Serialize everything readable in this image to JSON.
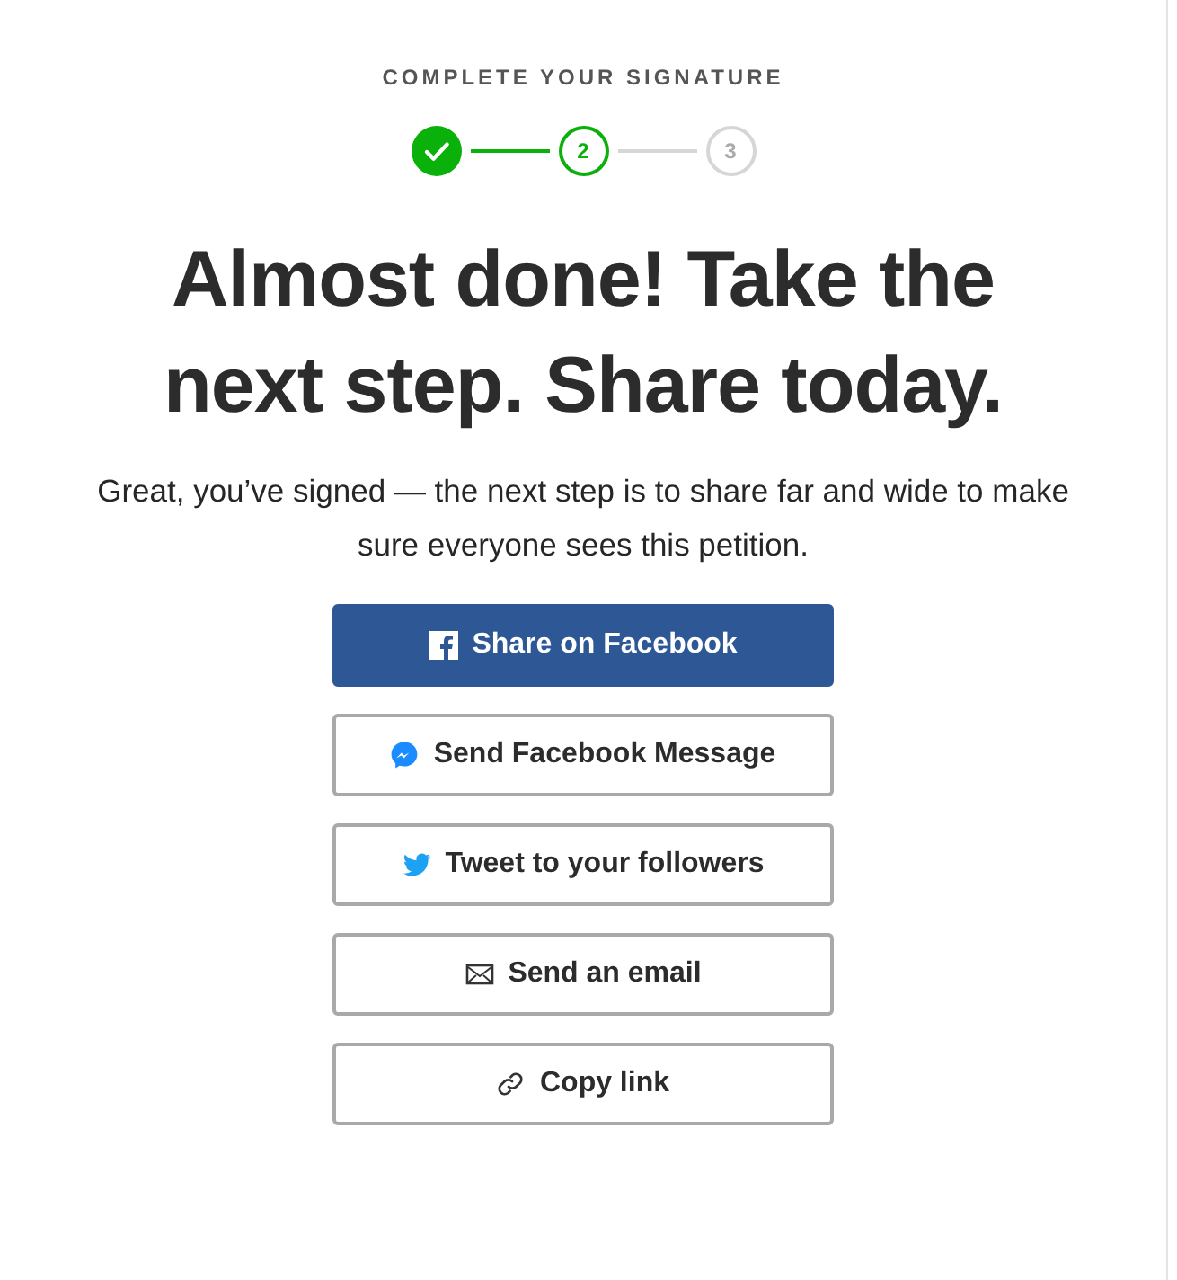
{
  "eyebrow": "COMPLETE YOUR SIGNATURE",
  "steps": [
    {
      "done": true,
      "selected": false
    },
    {
      "label": "2",
      "done": false,
      "selected": true
    },
    {
      "label": "3",
      "done": false,
      "selected": false
    }
  ],
  "headline": "Almost done! Take the next step. Share today.",
  "message": "Great, you’ve signed — the next step is to share far and wide to make sure everyone sees this petition.",
  "buttons": [
    {
      "kind": "facebook",
      "label": "Share on Facebook"
    },
    {
      "kind": "messenger",
      "label": "Send Facebook Message"
    },
    {
      "kind": "twitter",
      "label": "Tweet to your followers"
    },
    {
      "kind": "email",
      "label": "Send an email"
    },
    {
      "kind": "link",
      "label": "Copy link"
    }
  ]
}
